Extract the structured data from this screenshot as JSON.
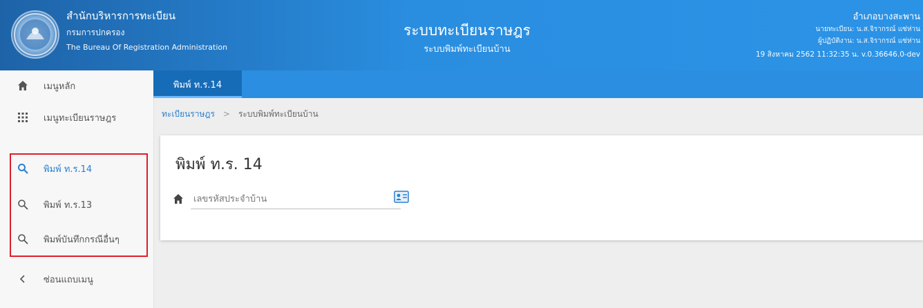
{
  "header": {
    "org_name": "สำนักบริหารการทะเบียน",
    "org_dept": "กรมการปกครอง",
    "org_en": "The Bureau Of Registration Administration",
    "system_title": "ระบบทะเบียนราษฎร",
    "system_subtitle": "ระบบพิมพ์ทะเบียนบ้าน",
    "office": "อำเภอบางสะพาน",
    "registrar": "นายทะเบียน: น.ส.จิรากรณ์ แซ่ห่าน",
    "operator": "ผู้ปฏิบัติงาน: น.ส.จิรากรณ์ แซ่ห่าน",
    "date_version": "19 สิงหาคม 2562 11:32:35 น.  v.0.36646.0-dev"
  },
  "sidebar": {
    "items": [
      {
        "label": "เมนูหลัก",
        "icon": "home-icon"
      },
      {
        "label": "เมนูทะเบียนราษฎร",
        "icon": "grid-icon"
      },
      {
        "label": "พิมพ์ ท.ร.14",
        "icon": "search-icon",
        "active": true
      },
      {
        "label": "พิมพ์ ท.ร.13",
        "icon": "search-icon"
      },
      {
        "label": "พิมพ์บันทึกกรณีอื่นๆ",
        "icon": "search-icon"
      },
      {
        "label": "ซ่อนแถบเมนู",
        "icon": "chevron-left-icon"
      }
    ]
  },
  "tabs": [
    {
      "label": "พิมพ์ ท.ร.14",
      "active": true
    }
  ],
  "breadcrumb": {
    "root": "ทะเบียนราษฎร",
    "separator": ">",
    "current": "ระบบพิมพ์ทะเบียนบ้าน"
  },
  "card": {
    "title": "พิมพ์ ท.ร. 14",
    "house_field": {
      "placeholder": "เลขรหัสประจำบ้าน",
      "value": ""
    }
  },
  "colors": {
    "header_start": "#1e63a8",
    "header_end": "#2b93e6",
    "tab_active": "#176cb8",
    "accent": "#2a7fd0",
    "highlight": "#e01d2a"
  }
}
